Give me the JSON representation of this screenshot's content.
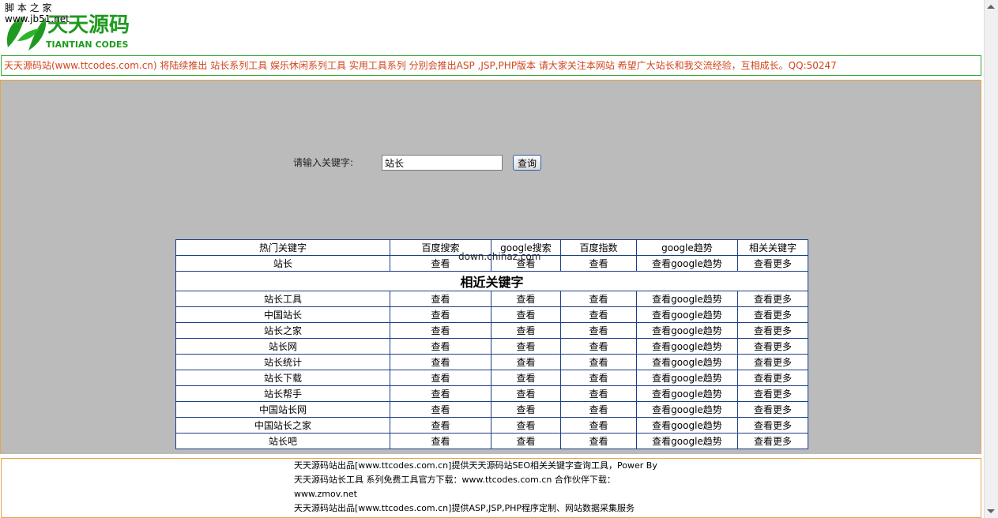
{
  "watermark": {
    "line1": "脚 本 之 家",
    "line2": "www.jb51.net"
  },
  "logo": {
    "main_text": "天天源码",
    "sub_text": "TIANTIAN CODES"
  },
  "notice": {
    "text": "天天源码站(www.ttcodes.com.cn) 将陆续推出 站长系列工具 娱乐休闲系列工具 实用工具系列 分别会推出ASP ,JSP,PHP版本 请大家关注本网站 希望广大站长和我交流经验，互相成长。QQ:50247"
  },
  "search": {
    "label": "请输入关键字:",
    "value": "站长",
    "button_label": "查询"
  },
  "overlay": {
    "text": "down.chinaz.com"
  },
  "table": {
    "headers": [
      "热门关键字",
      "百度搜索",
      "google搜索",
      "百度指数",
      "google趋势",
      "相关关键字"
    ],
    "main_row": {
      "keyword": "站长",
      "baidu": "查看",
      "google": "查看",
      "index": "查看",
      "trend": "查看google趋势",
      "more": "查看更多"
    },
    "section_title": "相近关键字",
    "rows": [
      {
        "keyword": "站长工具",
        "baidu": "查看",
        "google": "查看",
        "index": "查看",
        "trend": "查看google趋势",
        "more": "查看更多"
      },
      {
        "keyword": "中国站长",
        "baidu": "查看",
        "google": "查看",
        "index": "查看",
        "trend": "查看google趋势",
        "more": "查看更多"
      },
      {
        "keyword": "站长之家",
        "baidu": "查看",
        "google": "查看",
        "index": "查看",
        "trend": "查看google趋势",
        "more": "查看更多"
      },
      {
        "keyword": "站长网",
        "baidu": "查看",
        "google": "查看",
        "index": "查看",
        "trend": "查看google趋势",
        "more": "查看更多"
      },
      {
        "keyword": "站长统计",
        "baidu": "查看",
        "google": "查看",
        "index": "查看",
        "trend": "查看google趋势",
        "more": "查看更多"
      },
      {
        "keyword": "站长下载",
        "baidu": "查看",
        "google": "查看",
        "index": "查看",
        "trend": "查看google趋势",
        "more": "查看更多"
      },
      {
        "keyword": "站长帮手",
        "baidu": "查看",
        "google": "查看",
        "index": "查看",
        "trend": "查看google趋势",
        "more": "查看更多"
      },
      {
        "keyword": "中国站长网",
        "baidu": "查看",
        "google": "查看",
        "index": "查看",
        "trend": "查看google趋势",
        "more": "查看更多"
      },
      {
        "keyword": "中国站长之家",
        "baidu": "查看",
        "google": "查看",
        "index": "查看",
        "trend": "查看google趋势",
        "more": "查看更多"
      },
      {
        "keyword": "站长吧",
        "baidu": "查看",
        "google": "查看",
        "index": "查看",
        "trend": "查看google趋势",
        "more": "查看更多"
      }
    ]
  },
  "footer": {
    "lines": [
      "天天源码站出品[www.ttcodes.com.cn]提供天天源码站SEO相关关键字查询工具，Power By",
      "天天源码站长工具 系列免费工具官方下载：www.ttcodes.com.cn  合作伙伴下载：",
      "www.zmov.net",
      "天天源码站出品[www.ttcodes.com.cn]提供ASP,JSP,PHP程序定制、网站数据采集服务"
    ]
  },
  "colors": {
    "notice_text": "#d0451b",
    "main_bg": "#bbbbbb",
    "table_border": "#1c3f8a",
    "notice_border": "#33a633",
    "frame_border": "#e3a54a",
    "logo_green": "#1f9a1f"
  }
}
